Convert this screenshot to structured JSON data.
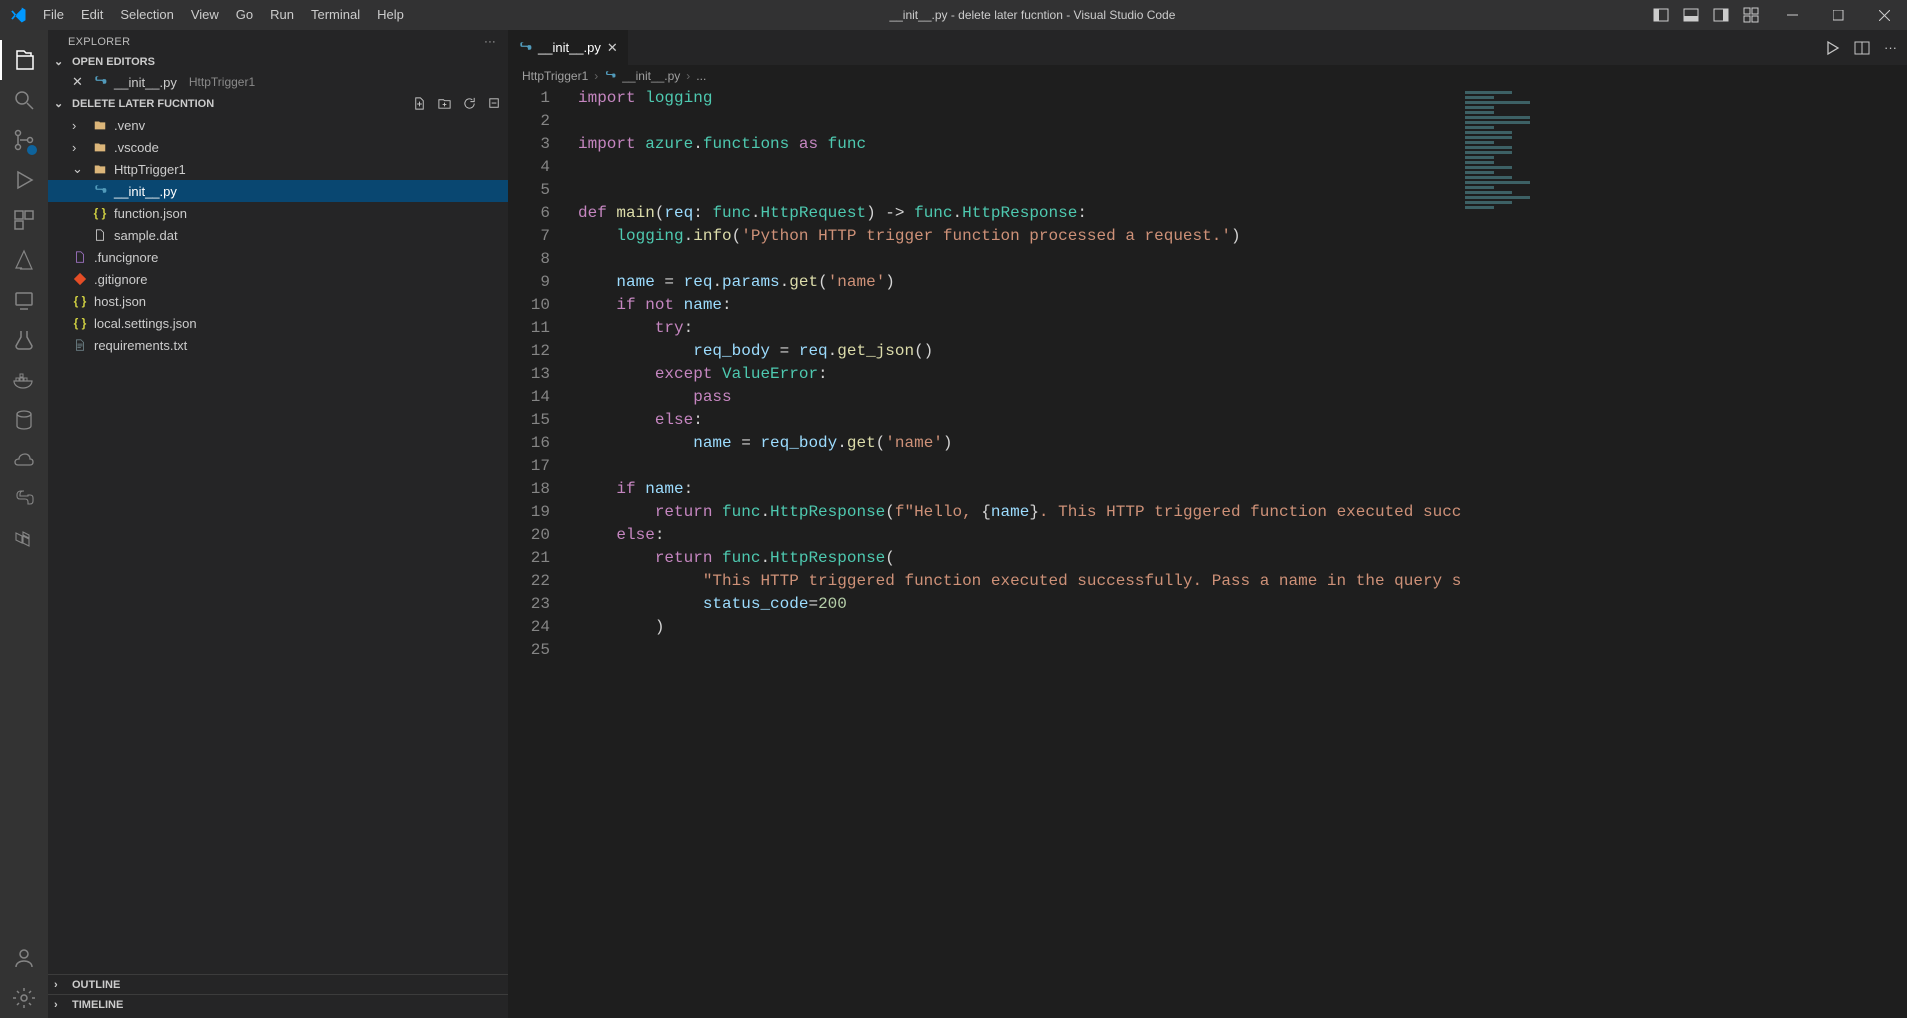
{
  "title_bar": {
    "menu": [
      "File",
      "Edit",
      "Selection",
      "View",
      "Go",
      "Run",
      "Terminal",
      "Help"
    ],
    "window_title": "__init__.py - delete later fucntion - Visual Studio Code"
  },
  "side_bar": {
    "title": "EXPLORER",
    "open_editors_header": "OPEN EDITORS",
    "workspace_header": "DELETE LATER FUCNTION",
    "open_editors": [
      {
        "name": "__init__.py",
        "path_hint": "HttpTrigger1"
      }
    ],
    "tree": [
      {
        "kind": "folder",
        "name": ".venv",
        "depth": 1,
        "expanded": false
      },
      {
        "kind": "folder",
        "name": ".vscode",
        "depth": 1,
        "expanded": false
      },
      {
        "kind": "folder",
        "name": "HttpTrigger1",
        "depth": 1,
        "expanded": true
      },
      {
        "kind": "file",
        "name": "__init__.py",
        "depth": 2,
        "icon": "py",
        "selected": true
      },
      {
        "kind": "file",
        "name": "function.json",
        "depth": 2,
        "icon": "json"
      },
      {
        "kind": "file",
        "name": "sample.dat",
        "depth": 2,
        "icon": "dat"
      },
      {
        "kind": "file",
        "name": ".funcignore",
        "depth": 1,
        "icon": "any"
      },
      {
        "kind": "file",
        "name": ".gitignore",
        "depth": 1,
        "icon": "git"
      },
      {
        "kind": "file",
        "name": "host.json",
        "depth": 1,
        "icon": "json"
      },
      {
        "kind": "file",
        "name": "local.settings.json",
        "depth": 1,
        "icon": "json"
      },
      {
        "kind": "file",
        "name": "requirements.txt",
        "depth": 1,
        "icon": "txt"
      }
    ],
    "outline_header": "OUTLINE",
    "timeline_header": "TIMELINE"
  },
  "editor": {
    "tab_label": "__init__.py",
    "breadcrumb": [
      "HttpTrigger1",
      "__init__.py",
      "..."
    ],
    "line_count": 25,
    "code_lines": {
      "l1": {
        "segs": [
          {
            "t": "import ",
            "c": "tk-key"
          },
          {
            "t": "logging",
            "c": "tk-mod"
          }
        ]
      },
      "l2": {
        "segs": [
          {
            "t": "",
            "c": ""
          }
        ]
      },
      "l3": {
        "segs": [
          {
            "t": "import ",
            "c": "tk-key"
          },
          {
            "t": "azure",
            "c": "tk-mod"
          },
          {
            "t": ".",
            "c": "tk-op"
          },
          {
            "t": "functions",
            "c": "tk-mod"
          },
          {
            "t": " as ",
            "c": "tk-key"
          },
          {
            "t": "func",
            "c": "tk-mod"
          }
        ]
      },
      "l4": {
        "segs": [
          {
            "t": "",
            "c": ""
          }
        ]
      },
      "l5": {
        "segs": [
          {
            "t": "",
            "c": ""
          }
        ]
      },
      "l6": {
        "segs": [
          {
            "t": "def ",
            "c": "tk-key"
          },
          {
            "t": "main",
            "c": "tk-func"
          },
          {
            "t": "(",
            "c": "tk-op"
          },
          {
            "t": "req",
            "c": "tk-var"
          },
          {
            "t": ": ",
            "c": "tk-op"
          },
          {
            "t": "func",
            "c": "tk-mod"
          },
          {
            "t": ".",
            "c": "tk-op"
          },
          {
            "t": "HttpRequest",
            "c": "tk-type"
          },
          {
            "t": ") -> ",
            "c": "tk-op"
          },
          {
            "t": "func",
            "c": "tk-mod"
          },
          {
            "t": ".",
            "c": "tk-op"
          },
          {
            "t": "HttpResponse",
            "c": "tk-type"
          },
          {
            "t": ":",
            "c": "tk-op"
          }
        ]
      },
      "l7": {
        "segs": [
          {
            "t": "    ",
            "c": ""
          },
          {
            "t": "logging",
            "c": "tk-mod"
          },
          {
            "t": ".",
            "c": "tk-op"
          },
          {
            "t": "info",
            "c": "tk-func"
          },
          {
            "t": "(",
            "c": "tk-op"
          },
          {
            "t": "'Python HTTP trigger function processed a request.'",
            "c": "tk-str"
          },
          {
            "t": ")",
            "c": "tk-op"
          }
        ]
      },
      "l8": {
        "segs": [
          {
            "t": "",
            "c": ""
          }
        ]
      },
      "l9": {
        "segs": [
          {
            "t": "    ",
            "c": ""
          },
          {
            "t": "name",
            "c": "tk-var"
          },
          {
            "t": " = ",
            "c": "tk-op"
          },
          {
            "t": "req",
            "c": "tk-var"
          },
          {
            "t": ".",
            "c": "tk-op"
          },
          {
            "t": "params",
            "c": "tk-var"
          },
          {
            "t": ".",
            "c": "tk-op"
          },
          {
            "t": "get",
            "c": "tk-func"
          },
          {
            "t": "(",
            "c": "tk-op"
          },
          {
            "t": "'name'",
            "c": "tk-str"
          },
          {
            "t": ")",
            "c": "tk-op"
          }
        ]
      },
      "l10": {
        "segs": [
          {
            "t": "    ",
            "c": ""
          },
          {
            "t": "if ",
            "c": "tk-key"
          },
          {
            "t": "not ",
            "c": "tk-key"
          },
          {
            "t": "name",
            "c": "tk-var"
          },
          {
            "t": ":",
            "c": "tk-op"
          }
        ]
      },
      "l11": {
        "segs": [
          {
            "t": "        ",
            "c": ""
          },
          {
            "t": "try",
            "c": "tk-key"
          },
          {
            "t": ":",
            "c": "tk-op"
          }
        ]
      },
      "l12": {
        "segs": [
          {
            "t": "            ",
            "c": ""
          },
          {
            "t": "req_body",
            "c": "tk-var"
          },
          {
            "t": " = ",
            "c": "tk-op"
          },
          {
            "t": "req",
            "c": "tk-var"
          },
          {
            "t": ".",
            "c": "tk-op"
          },
          {
            "t": "get_json",
            "c": "tk-func"
          },
          {
            "t": "()",
            "c": "tk-op"
          }
        ]
      },
      "l13": {
        "segs": [
          {
            "t": "        ",
            "c": ""
          },
          {
            "t": "except ",
            "c": "tk-key"
          },
          {
            "t": "ValueError",
            "c": "tk-type"
          },
          {
            "t": ":",
            "c": "tk-op"
          }
        ]
      },
      "l14": {
        "segs": [
          {
            "t": "            ",
            "c": ""
          },
          {
            "t": "pass",
            "c": "tk-key"
          }
        ]
      },
      "l15": {
        "segs": [
          {
            "t": "        ",
            "c": ""
          },
          {
            "t": "else",
            "c": "tk-key"
          },
          {
            "t": ":",
            "c": "tk-op"
          }
        ]
      },
      "l16": {
        "segs": [
          {
            "t": "            ",
            "c": ""
          },
          {
            "t": "name",
            "c": "tk-var"
          },
          {
            "t": " = ",
            "c": "tk-op"
          },
          {
            "t": "req_body",
            "c": "tk-var"
          },
          {
            "t": ".",
            "c": "tk-op"
          },
          {
            "t": "get",
            "c": "tk-func"
          },
          {
            "t": "(",
            "c": "tk-op"
          },
          {
            "t": "'name'",
            "c": "tk-str"
          },
          {
            "t": ")",
            "c": "tk-op"
          }
        ]
      },
      "l17": {
        "segs": [
          {
            "t": "",
            "c": ""
          }
        ]
      },
      "l18": {
        "segs": [
          {
            "t": "    ",
            "c": ""
          },
          {
            "t": "if ",
            "c": "tk-key"
          },
          {
            "t": "name",
            "c": "tk-var"
          },
          {
            "t": ":",
            "c": "tk-op"
          }
        ]
      },
      "l19": {
        "segs": [
          {
            "t": "        ",
            "c": ""
          },
          {
            "t": "return ",
            "c": "tk-key"
          },
          {
            "t": "func",
            "c": "tk-mod"
          },
          {
            "t": ".",
            "c": "tk-op"
          },
          {
            "t": "HttpResponse",
            "c": "tk-type"
          },
          {
            "t": "(",
            "c": "tk-op"
          },
          {
            "t": "f\"Hello, ",
            "c": "tk-str"
          },
          {
            "t": "{",
            "c": "tk-op"
          },
          {
            "t": "name",
            "c": "tk-var"
          },
          {
            "t": "}",
            "c": "tk-op"
          },
          {
            "t": ". This HTTP triggered function executed succ",
            "c": "tk-str"
          }
        ]
      },
      "l20": {
        "segs": [
          {
            "t": "    ",
            "c": ""
          },
          {
            "t": "else",
            "c": "tk-key"
          },
          {
            "t": ":",
            "c": "tk-op"
          }
        ]
      },
      "l21": {
        "segs": [
          {
            "t": "        ",
            "c": ""
          },
          {
            "t": "return ",
            "c": "tk-key"
          },
          {
            "t": "func",
            "c": "tk-mod"
          },
          {
            "t": ".",
            "c": "tk-op"
          },
          {
            "t": "HttpResponse",
            "c": "tk-type"
          },
          {
            "t": "(",
            "c": "tk-op"
          }
        ]
      },
      "l22": {
        "segs": [
          {
            "t": "             ",
            "c": ""
          },
          {
            "t": "\"This HTTP triggered function executed successfully. Pass a name in the query s",
            "c": "tk-str"
          }
        ]
      },
      "l23": {
        "segs": [
          {
            "t": "             ",
            "c": ""
          },
          {
            "t": "status_code",
            "c": "tk-var"
          },
          {
            "t": "=",
            "c": "tk-op"
          },
          {
            "t": "200",
            "c": "tk-num"
          }
        ]
      },
      "l24": {
        "segs": [
          {
            "t": "        )",
            "c": "tk-op"
          }
        ]
      },
      "l25": {
        "segs": [
          {
            "t": "",
            "c": ""
          }
        ]
      }
    }
  }
}
